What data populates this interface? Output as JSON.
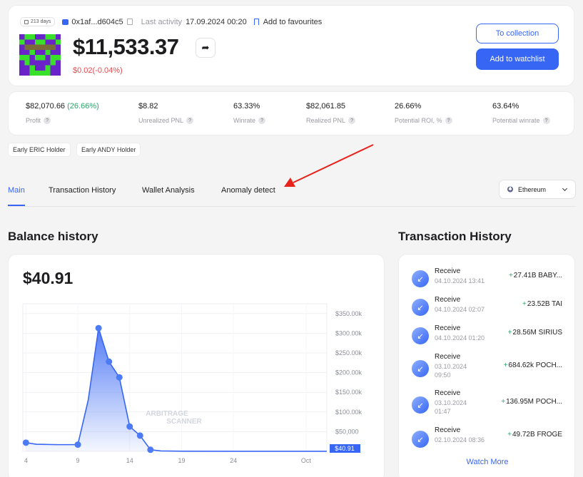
{
  "header": {
    "days_badge": "213 days",
    "address": "0x1af...d604c5",
    "last_activity_label": "Last activity",
    "last_activity_value": "17.09.2024 00:20",
    "favourites_label": "Add to favourites",
    "balance": "$11,533.37",
    "change": "$0.02(-0.04%)",
    "to_collection": "To collection",
    "add_watchlist": "Add to watchlist"
  },
  "stats": [
    {
      "value": "$82,070.66",
      "extra": "(26.66%)",
      "label": "Profit"
    },
    {
      "value": "$8.82",
      "extra": "",
      "label": "Unrealized PNL"
    },
    {
      "value": "63.33%",
      "extra": "",
      "label": "Winrate"
    },
    {
      "value": "$82,061.85",
      "extra": "",
      "label": "Realized PNL"
    },
    {
      "value": "26.66%",
      "extra": "",
      "label": "Potential ROI, %"
    },
    {
      "value": "63.64%",
      "extra": "",
      "label": "Potential winrate"
    }
  ],
  "tags": [
    "Early ERIC Holder",
    "Early ANDY Holder"
  ],
  "tabs": [
    "Main",
    "Transaction History",
    "Wallet Analysis",
    "Anomaly detect"
  ],
  "chain": "Ethereum",
  "balance_history": {
    "title": "Balance history",
    "value": "$40.91",
    "watermark_line1": "ARBITRAGE",
    "watermark_line2": "SCANNER"
  },
  "chart_data": {
    "type": "area",
    "x_ticks": [
      "4",
      "9",
      "14",
      "19",
      "24",
      "Oct"
    ],
    "y_ticks": [
      "$50,000",
      "$100.00k",
      "$150.00k",
      "$200.00k",
      "$250.00k",
      "$300.00k",
      "$350.00k"
    ],
    "current_label": "$40.91",
    "ylim": [
      0,
      375000
    ],
    "points": [
      {
        "x": 4,
        "y": 22000,
        "marker": true
      },
      {
        "x": 5,
        "y": 18000,
        "marker": false
      },
      {
        "x": 7,
        "y": 17000,
        "marker": false
      },
      {
        "x": 9,
        "y": 17000,
        "marker": true
      },
      {
        "x": 10,
        "y": 130000,
        "marker": false
      },
      {
        "x": 11,
        "y": 313000,
        "marker": true
      },
      {
        "x": 12,
        "y": 228000,
        "marker": true
      },
      {
        "x": 13,
        "y": 188000,
        "marker": true
      },
      {
        "x": 14,
        "y": 63000,
        "marker": true
      },
      {
        "x": 15,
        "y": 40000,
        "marker": true
      },
      {
        "x": 16,
        "y": 4000,
        "marker": true
      },
      {
        "x": 17,
        "y": 1000,
        "marker": false
      },
      {
        "x": 19,
        "y": 300,
        "marker": false
      },
      {
        "x": 25,
        "y": 100,
        "marker": false
      },
      {
        "x": 31,
        "y": 41,
        "marker": false
      }
    ]
  },
  "transactions": {
    "title": "Transaction History",
    "watch_more": "Watch More",
    "items": [
      {
        "type": "Receive",
        "date": "04.10.2024 13:41",
        "amount": "27.41B BABY..."
      },
      {
        "type": "Receive",
        "date": "04.10.2024 02:07",
        "amount": "23.52B TAI"
      },
      {
        "type": "Receive",
        "date": "04.10.2024 01:20",
        "amount": "28.56M SIRIUS"
      },
      {
        "type": "Receive",
        "date": "03.10.2024 09:50",
        "amount": "684.62k POCH..."
      },
      {
        "type": "Receive",
        "date": "03.10.2024 01:47",
        "amount": "136.95M POCH..."
      },
      {
        "type": "Receive",
        "date": "02.10.2024 08:36",
        "amount": "49.72B FROGE"
      }
    ]
  },
  "colors": {
    "accent": "#3766f4",
    "positive": "#30a46c",
    "negative": "#e5484d",
    "annotation_arrow": "#e8231c"
  }
}
